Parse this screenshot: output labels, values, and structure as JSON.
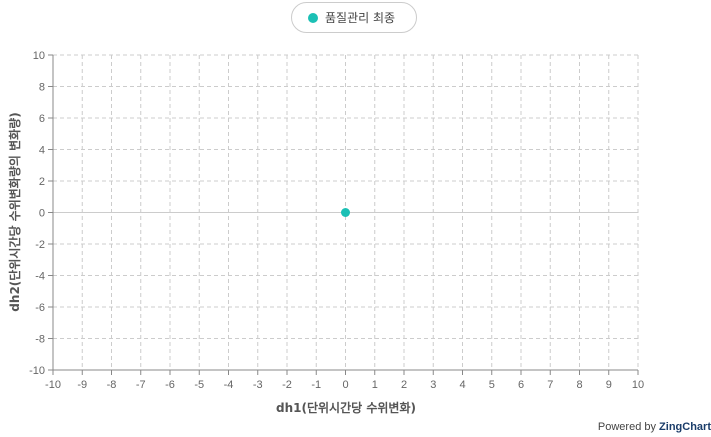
{
  "legend": {
    "label": "품질관리 최종"
  },
  "footer": {
    "powered_by": "Powered by ",
    "brand": "ZingChart"
  },
  "colors": {
    "series": "#1bc0b5",
    "grid": "#cccccc",
    "axis": "#888888",
    "zero_line": "#cccccc"
  },
  "chart_data": {
    "type": "scatter",
    "title": "",
    "xlabel": "dh1(단위시간당 수위변화)",
    "ylabel": "dh2(단위시간당 수위변화량의 변화량)",
    "xlim": [
      -10,
      10
    ],
    "ylim": [
      -10,
      10
    ],
    "x_ticks": [
      "-10",
      "-9",
      "-8",
      "-7",
      "-6",
      "-5",
      "-4",
      "-3",
      "-2",
      "-1",
      "0",
      "1",
      "2",
      "3",
      "4",
      "5",
      "6",
      "7",
      "8",
      "9",
      "10"
    ],
    "y_ticks": [
      "10",
      "8",
      "6",
      "4",
      "2",
      "0",
      "-2",
      "-4",
      "-6",
      "-8",
      "-10"
    ],
    "grid": true,
    "legend_position": "top-center",
    "series": [
      {
        "name": "품질관리 최종",
        "points": [
          {
            "x": 0,
            "y": 0
          }
        ]
      }
    ]
  }
}
